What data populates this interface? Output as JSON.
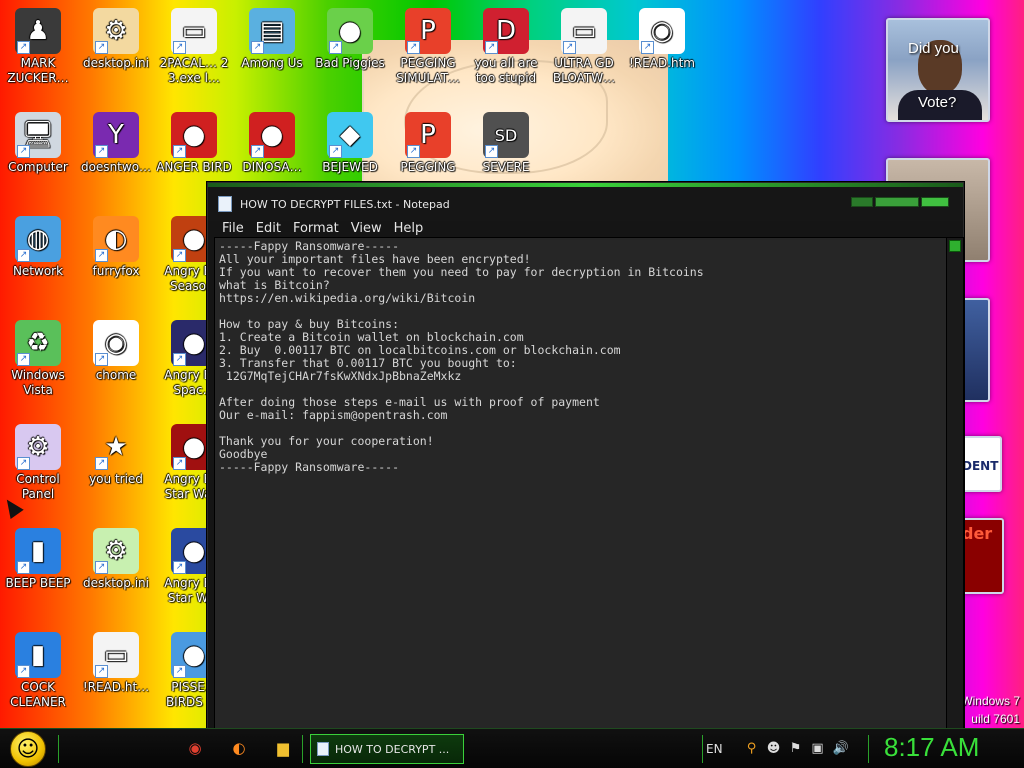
{
  "desktop": {
    "icons": [
      {
        "label": "MARK ZUCKER…",
        "icon": "person-icon",
        "glyph": "♟",
        "bg": "#3a3a3a"
      },
      {
        "label": "desktop.ini",
        "icon": "settings-file-icon",
        "glyph": "⚙",
        "bg": "#f3d9a0"
      },
      {
        "label": "2PACAL… 2 3.exe l…",
        "icon": "file-icon",
        "glyph": "▭",
        "bg": "#f4f4f4"
      },
      {
        "label": "Among Us",
        "icon": "among-us-icon",
        "glyph": "▤",
        "bg": "#5ab0e0"
      },
      {
        "label": "Bad Piggies",
        "icon": "bad-piggies-icon",
        "glyph": "●",
        "bg": "#6ad04a"
      },
      {
        "label": "PEGGING SIMULAT…",
        "icon": "pegging-icon",
        "glyph": "P",
        "bg": "#e8402a"
      },
      {
        "label": "you all are too stupid",
        "icon": "dev-cpp-icon",
        "glyph": "D",
        "bg": "#d02030"
      },
      {
        "label": "ULTRA GD BLOATW…",
        "icon": "file-icon",
        "glyph": "▭",
        "bg": "#f4f4f4"
      },
      {
        "label": "!READ.htm",
        "icon": "chrome-icon",
        "glyph": "◉",
        "bg": "#ffffff"
      },
      {
        "label": "Computer",
        "icon": "computer-icon",
        "glyph": "🖥",
        "bg": "#d0d8e0"
      },
      {
        "label": "doesntwo…",
        "icon": "yahoo-icon",
        "glyph": "Y",
        "bg": "#7a2ab0"
      },
      {
        "label": "ANGER BIRD",
        "icon": "angry-birds-icon",
        "glyph": "●",
        "bg": "#d02020"
      },
      {
        "label": "DINOSA…",
        "icon": "angry-birds-icon",
        "glyph": "●",
        "bg": "#d02020"
      },
      {
        "label": "BEJEWED",
        "icon": "gem-icon",
        "glyph": "◆",
        "bg": "#40c8f0"
      },
      {
        "label": "PEGGING",
        "icon": "pegging-icon",
        "glyph": "P",
        "bg": "#e8402a"
      },
      {
        "label": "SEVERE",
        "icon": "sd-icon",
        "glyph": "SD",
        "bg": "#505050"
      },
      {
        "label": "Network",
        "icon": "network-icon",
        "glyph": "◍",
        "bg": "#4aa0e0"
      },
      {
        "label": "furryfox",
        "icon": "firefox-icon",
        "glyph": "◐",
        "bg": "#ff8a20"
      },
      {
        "label": "Angry B… Seaso…",
        "icon": "angry-birds-seasons-icon",
        "glyph": "●",
        "bg": "#c04010"
      },
      {
        "label": "Windows Vista",
        "icon": "recycle-bin-icon",
        "glyph": "♻",
        "bg": "#5ac05a"
      },
      {
        "label": "chome",
        "icon": "chrome-icon",
        "glyph": "◉",
        "bg": "#ffffff"
      },
      {
        "label": "Angry B… Spac…",
        "icon": "angry-birds-space-icon",
        "glyph": "●",
        "bg": "#2a2a6a"
      },
      {
        "label": "Control Panel",
        "icon": "control-panel-icon",
        "glyph": "⚙",
        "bg": "#d8c8f0"
      },
      {
        "label": "you tried",
        "icon": "star-icon",
        "glyph": "★",
        "bg": "transparent"
      },
      {
        "label": "Angry B… Star Wa…",
        "icon": "angry-birds-star-wars-icon",
        "glyph": "●",
        "bg": "#a01010"
      },
      {
        "label": "BEEP BEEP",
        "icon": "blue-book-icon",
        "glyph": "▮",
        "bg": "#2a80e0"
      },
      {
        "label": "desktop.ini",
        "icon": "settings-file-icon",
        "glyph": "⚙",
        "bg": "#c8f0b0"
      },
      {
        "label": "Angry B… Star W…",
        "icon": "angry-birds-star-wars-icon",
        "glyph": "●",
        "bg": "#2a4aa0"
      },
      {
        "label": "COCK CLEANER",
        "icon": "blue-book-icon",
        "glyph": "▮",
        "bg": "#2a80e0"
      },
      {
        "label": "!READ.ht…",
        "icon": "file-icon",
        "glyph": "▭",
        "bg": "#f4f4f4"
      },
      {
        "label": "PISSE… BIRDS l…",
        "icon": "angry-birds-icon",
        "glyph": "●",
        "bg": "#4a9ae0"
      }
    ],
    "gadgets": {
      "obama_top": "Did you",
      "obama_bottom": "Vote?",
      "news_badge": "DENT",
      "red_badge": "der",
      "os_line1": "Windows 7",
      "os_line2": "uild 7601"
    }
  },
  "window": {
    "title": "HOW TO DECRYPT FILES.txt - Notepad",
    "menu": [
      "File",
      "Edit",
      "Format",
      "View",
      "Help"
    ],
    "content": "-----Fappy Ransomware-----\nAll your important files have been encrypted!\nIf you want to recover them you need to pay for decryption in Bitcoins\nwhat is Bitcoin?\nhttps://en.wikipedia.org/wiki/Bitcoin\n\nHow to pay & buy Bitcoins:\n1. Create a Bitcoin wallet on blockchain.com\n2. Buy  0.00117 BTC on localbitcoins.com or blockchain.com\n3. Transfer that 0.00117 BTC you bought to:\n 12G7MqTejCHAr7fsKwXNdxJpBbnaZeMxkz\n\nAfter doing those steps e-mail us with proof of payment\nOur e-mail: fappism@opentrash.com\n\nThank you for your cooperation!\nGoodbye\n-----Fappy Ransomware-----"
  },
  "taskbar": {
    "pinned": [
      {
        "icon": "chrome-icon",
        "glyph": "◉",
        "color": "#e04030"
      },
      {
        "icon": "firefox-icon",
        "glyph": "◐",
        "color": "#ff8a20"
      },
      {
        "icon": "folder-icon",
        "glyph": "▆",
        "color": "#f0c030"
      }
    ],
    "task_label": "HOW TO DECRYPT ...",
    "language": "EN",
    "tray_icons": [
      {
        "icon": "search-icon",
        "glyph": "⚲",
        "color": "#f0a020"
      },
      {
        "icon": "messenger-icon",
        "glyph": "☻",
        "color": "#dddddd"
      },
      {
        "icon": "action-center-flag-icon",
        "glyph": "⚑",
        "color": "#dddddd"
      },
      {
        "icon": "network-tray-icon",
        "glyph": "▣",
        "color": "#dddddd"
      },
      {
        "icon": "volume-icon",
        "glyph": "🔊",
        "color": "#dddddd"
      }
    ],
    "clock": "8:17 AM"
  }
}
